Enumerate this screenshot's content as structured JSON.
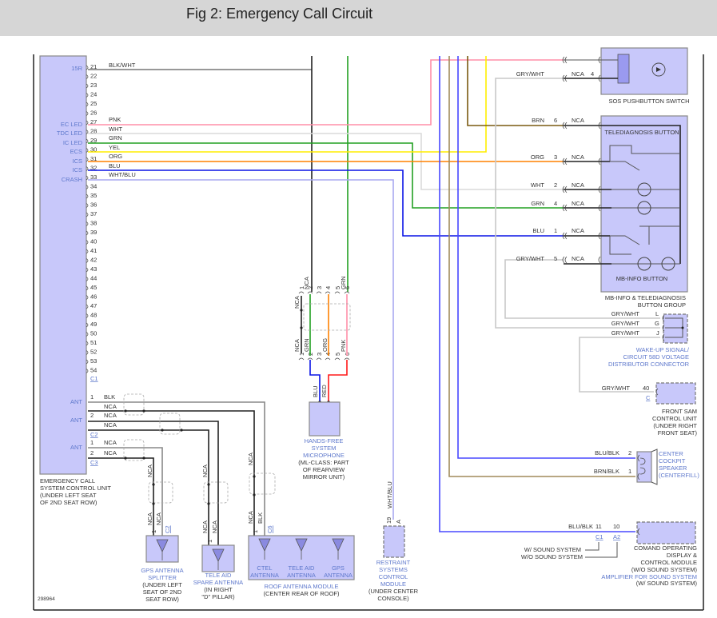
{
  "title": "Fig 2: Emergency Call Circuit",
  "diagram_id": "298964",
  "wire_colors": {
    "PNK": "#ff8fa8",
    "WHT": "#dadada",
    "GRN": "#22a022",
    "YEL": "#ffee00",
    "ORG": "#ff8000",
    "BLU": "#0a14e6",
    "WHT/BLU": "#a8a8f0",
    "BRN": "#7a5a10",
    "BRN/BLK": "#a08a5a",
    "GRY/WHT": "#c8c8c8",
    "BLU/BLK": "#4848ff",
    "BLK/WHT": "#777777",
    "BLK": "#222222",
    "RED": "#ff1a1a"
  },
  "control_unit": {
    "name": [
      "EMERGENCY CALL",
      "SYSTEM CONTROL UNIT",
      "(UNDER LEFT SEAT",
      "OF 2ND SEAT ROW)"
    ],
    "pins": [
      "21",
      "22",
      "23",
      "24",
      "25",
      "26",
      "27",
      "28",
      "29",
      "30",
      "31",
      "32",
      "33",
      "34",
      "35",
      "36",
      "37",
      "38",
      "39",
      "40",
      "41",
      "42",
      "43",
      "44",
      "45",
      "46",
      "47",
      "48",
      "49",
      "50",
      "51",
      "52",
      "53",
      "54"
    ],
    "pin_labels": {
      "p21": "15R",
      "p27": "EC LED",
      "p28": "TDC LED",
      "p29": "IC LED",
      "p30": "ECS",
      "p31": "ICS",
      "p32": "ICS",
      "p33": "CRASH"
    },
    "wire_labels": {
      "p21": "BLK/WHT",
      "p27": "PNK",
      "p28": "WHT",
      "p29": "GRN",
      "p30": "YEL",
      "p31": "ORG",
      "p32": "BLU",
      "p33": "WHT/BLU"
    },
    "connector_c1": "C1",
    "ant_label": "ANT",
    "c2": {
      "connector": "C2",
      "pins": [
        "1",
        "",
        "2",
        ""
      ],
      "wires": [
        "BLK",
        "NCA",
        "NCA",
        "NCA"
      ]
    },
    "c3": {
      "connector": "C3",
      "pins": [
        "1",
        "2"
      ],
      "wires": [
        "NCA",
        "NCA"
      ]
    }
  },
  "gps_splitter": {
    "name": [
      "GPS ANTENNA",
      "SPLITTER"
    ],
    "location": [
      "(UNDER LEFT",
      "SEAT OF 2ND",
      "SEAT ROW)"
    ],
    "wires": [
      "NCA",
      "NCA",
      "NCA"
    ],
    "pins": [
      "1",
      "2"
    ],
    "connector": "C2"
  },
  "tele_aid_spare": {
    "name": [
      "TELE AID",
      "SPARE ANTENNA"
    ],
    "location": [
      "(IN RIGHT",
      "\"D\" PILLAR)"
    ],
    "wires": [
      "NCA",
      "NCA",
      "NCA"
    ],
    "pins": [
      "1"
    ]
  },
  "roof_module": {
    "antennas": [
      [
        "CTEL",
        "ANTENNA"
      ],
      [
        "TELE AID",
        "ANTENNA"
      ],
      [
        "GPS",
        "ANTENNA"
      ]
    ],
    "name": "ROOF ANTENNA MODULE",
    "location": "(CENTER REAR OF ROOF)",
    "wires": [
      "NCA",
      "NCA",
      "BLK"
    ],
    "pins": [
      "1"
    ],
    "connector": "C6"
  },
  "microphone": {
    "top_wires": [
      "NCA",
      "GRN"
    ],
    "top_pins": [
      "1",
      "2",
      "3",
      "4",
      "5",
      "6"
    ],
    "mid_wires": [
      "NCA",
      "NCA",
      "GRN",
      "ORG",
      "PNK"
    ],
    "bottom_pins": [
      "1",
      "2",
      "3",
      "4",
      "5",
      "6"
    ],
    "leads": [
      "BLU",
      "RED"
    ],
    "name": [
      "HANDS-FREE",
      "SYSTEM",
      "MICROPHONE"
    ],
    "location": [
      "(ML-CLASS: PART",
      "OF REARVIEW",
      "MIRROR UNIT)"
    ]
  },
  "restraint": {
    "wire": "WHT/BLU",
    "pin": "19",
    "connector": "A",
    "name": [
      "RESTRAINT",
      "SYSTEMS",
      "CONTROL",
      "MODULE"
    ],
    "location": [
      "(UNDER CENTER",
      "CONSOLE)"
    ]
  },
  "sos_switch": {
    "name": "SOS PUSHBUTTON SWITCH",
    "rows": [
      {
        "wire": "GRY/WHT",
        "nca": "NCA",
        "pin": "4"
      }
    ]
  },
  "mb_info_group": {
    "rows": [
      {
        "wire": "BRN",
        "pin": "6",
        "nca": "NCA"
      },
      {
        "wire": "ORG",
        "pin": "3",
        "nca": "NCA"
      },
      {
        "wire": "WHT",
        "pin": "2",
        "nca": "NCA"
      },
      {
        "wire": "GRN",
        "pin": "4",
        "nca": "NCA"
      },
      {
        "wire": "BLU",
        "pin": "1",
        "nca": "NCA"
      },
      {
        "wire": "GRY/WHT",
        "pin": "5",
        "nca": "NCA"
      }
    ],
    "teled_label": "TELEDIAGNOSIS BUTTON",
    "mbinfo_label": "MB-INFO BUTTON",
    "name": [
      "MB-INFO & TELEDIAGNOSIS",
      "BUTTON GROUP"
    ]
  },
  "wakeup": {
    "rows": [
      {
        "wire": "GRY/WHT",
        "pin": "L"
      },
      {
        "wire": "GRY/WHT",
        "pin": "G"
      },
      {
        "wire": "GRY/WHT",
        "pin": "J"
      }
    ],
    "name": [
      "WAKE-UP SIGNAL/",
      "CIRCUIT 58D VOLTAGE",
      "DISTRIBUTOR CONNECTOR"
    ]
  },
  "front_sam": {
    "wire": "GRY/WHT",
    "pin": "40",
    "connector": "C",
    "name": [
      "FRONT SAM",
      "CONTROL UNIT",
      "(UNDER RIGHT",
      "FRONT SEAT)"
    ]
  },
  "speaker": {
    "rows": [
      {
        "wire": "BLU/BLK",
        "pin": "2"
      },
      {
        "wire": "BRN/BLK",
        "pin": "1"
      }
    ],
    "name": [
      "CENTER",
      "COCKPIT",
      "SPEAKER",
      "(CENTERFILL)"
    ]
  },
  "comand": {
    "wire": "BLU/BLK",
    "pin_c1": "11",
    "pin_a2": "10",
    "conn_c1": "C1",
    "conn_a2": "A2",
    "with_sound": "W/ SOUND SYSTEM",
    "without_sound": "W/O SOUND SYSTEM",
    "name": [
      "COMAND OPERATING",
      "DISPLAY &",
      "CONTROL MODULE",
      "(W/O SOUND SYSTEM)"
    ],
    "alt_name": [
      "AMPLIFIER FOR SOUND SYSTEM",
      "(W/ SOUND SYSTEM)"
    ]
  }
}
